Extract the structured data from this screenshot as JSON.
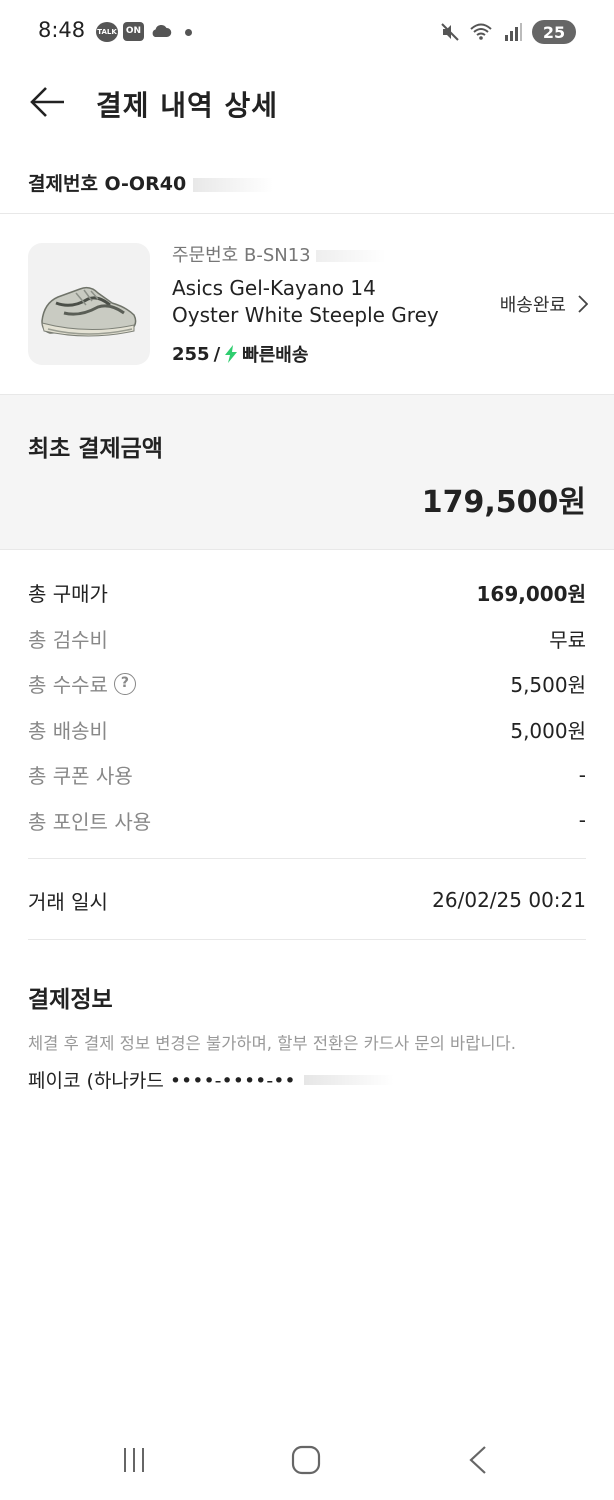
{
  "status_bar": {
    "time": "8:48",
    "talk_badge": "TALK",
    "on_badge": "ON",
    "battery": "25"
  },
  "header": {
    "title": "결제 내역 상세"
  },
  "payment_number": {
    "label": "결제번호",
    "value": "O-OR40"
  },
  "product": {
    "order_label": "주문번호",
    "order_value": "B-SN13",
    "name_line1": "Asics Gel-Kayano 14",
    "name_line2": "Oyster White Steeple Grey",
    "size": "255",
    "separator": "/",
    "shipping_type": "빠른배송",
    "status": "배송완료",
    "accent_color": "#2fcd6f"
  },
  "initial_payment": {
    "label": "최초 결제금액",
    "amount": "179,500원"
  },
  "price_rows": [
    {
      "label": "총 구매가",
      "value": "169,000원"
    },
    {
      "label": "총 검수비",
      "value": "무료"
    },
    {
      "label": "총 수수료",
      "value": "5,500원"
    },
    {
      "label": "총 배송비",
      "value": "5,000원"
    },
    {
      "label": "총 쿠폰 사용",
      "value": "-"
    },
    {
      "label": "총 포인트 사용",
      "value": "-"
    }
  ],
  "trade": {
    "label": "거래 일시",
    "value": "26/02/25 00:21"
  },
  "payment_info": {
    "title": "결제정보",
    "notice": "체결 후 결제 정보 변경은 불가하며, 할부 전환은 카드사 문의 바랍니다.",
    "method": "페이코 (하나카드 ••••-••••-••"
  }
}
